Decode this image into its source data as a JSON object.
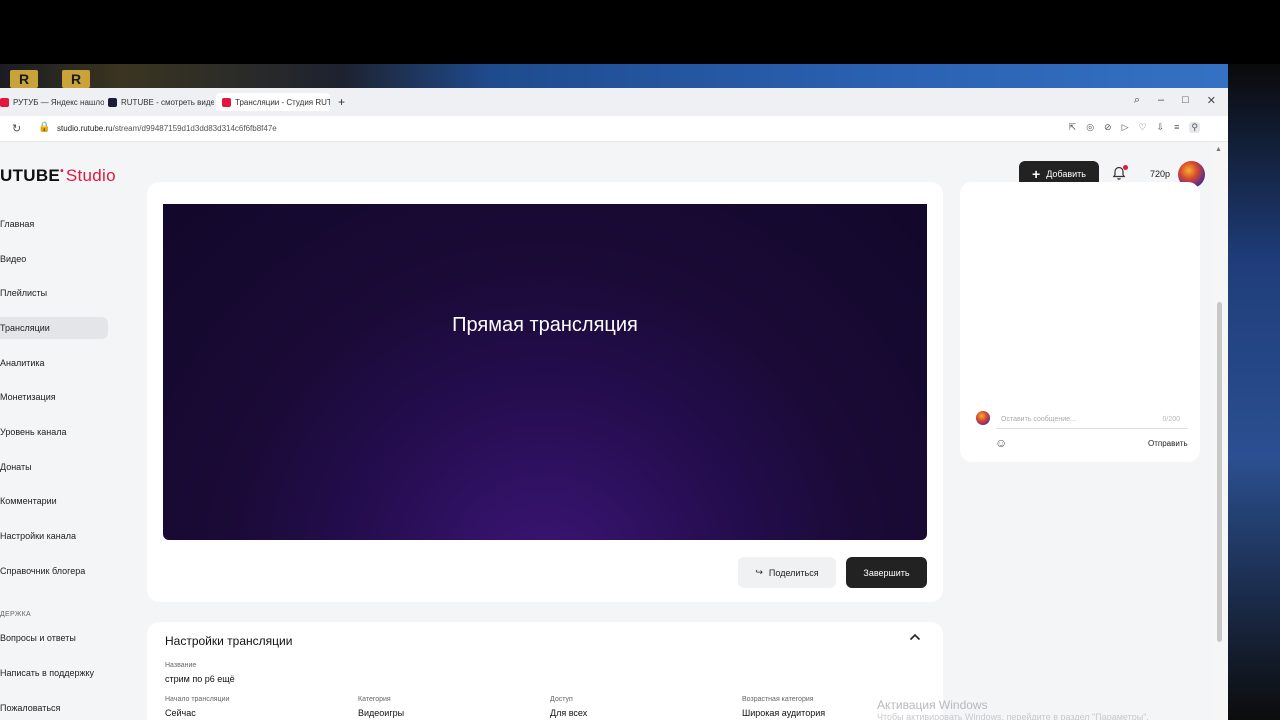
{
  "desktop": {
    "icon_1": "R",
    "icon_2": "R"
  },
  "browser": {
    "tabs": [
      {
        "label": "РУТУБ — Яндекс нашлось",
        "favicon_color": "#e3173e"
      },
      {
        "label": "RUTUBE - смотреть видео",
        "favicon_color": "#1b1b3a"
      },
      {
        "label": "Трансляции - Студия RUTUBE",
        "favicon_color": "#e3173e",
        "active": true
      }
    ],
    "new_tab": "+",
    "window_controls": [
      "⌕",
      "–",
      "□",
      "✕"
    ],
    "url_domain": "studio.rutube.ru",
    "url_path": "/stream/d99487159d1d3dd83d314c6f6fb8f47e",
    "reload_icon": "↻",
    "lock_icon": "🔒",
    "addr_icons": [
      "⇱",
      "◎",
      "⊘",
      "▷",
      "♡",
      "⇩",
      "≡",
      "⚲"
    ]
  },
  "header": {
    "logo_main": "UTUBE",
    "logo_studio": "Studio",
    "add_button": "Добавить",
    "add_icon": "+",
    "bell_icon": "🔔",
    "quality": "720p"
  },
  "sidebar": {
    "items": [
      {
        "label": "Главная"
      },
      {
        "label": "Видео"
      },
      {
        "label": "Плейлисты"
      },
      {
        "label": "Трансляции",
        "active": true
      },
      {
        "label": "Аналитика"
      },
      {
        "label": "Монетизация"
      },
      {
        "label": "Уровень канала"
      },
      {
        "label": "Донаты"
      },
      {
        "label": "Комментарии"
      },
      {
        "label": "Настройки канала"
      },
      {
        "label": "Справочник блогера"
      }
    ],
    "support_section": "ДЕРЖКА",
    "support_items": [
      {
        "label": "Вопросы и ответы"
      },
      {
        "label": "Написать в поддержку"
      },
      {
        "label": "Пожаловаться"
      }
    ]
  },
  "player": {
    "title": "Прямая трансляция",
    "share_label": "Поделиться",
    "share_icon": "↪",
    "finish_label": "Завершить"
  },
  "chat": {
    "placeholder": "Оставить сообщение...",
    "counter": "0/200",
    "emoji_icon": "☺",
    "send_label": "Отправить"
  },
  "settings": {
    "title": "Настройки трансляции",
    "chevron_icon": "⌃",
    "name_label": "Название",
    "name_value": "стрим по р6 ещё",
    "fields": [
      {
        "label": "Начало трансляции",
        "value": "Сейчас"
      },
      {
        "label": "Категория",
        "value": "Видеоигры"
      },
      {
        "label": "Доступ",
        "value": "Для всех"
      },
      {
        "label": "Возрастная категория",
        "value": "Широкая аудитория"
      }
    ]
  },
  "os_watermark": {
    "title": "Активация Windows",
    "subtitle": "Чтобы активировать Windows, перейдите в раздел \"Параметры\"."
  }
}
